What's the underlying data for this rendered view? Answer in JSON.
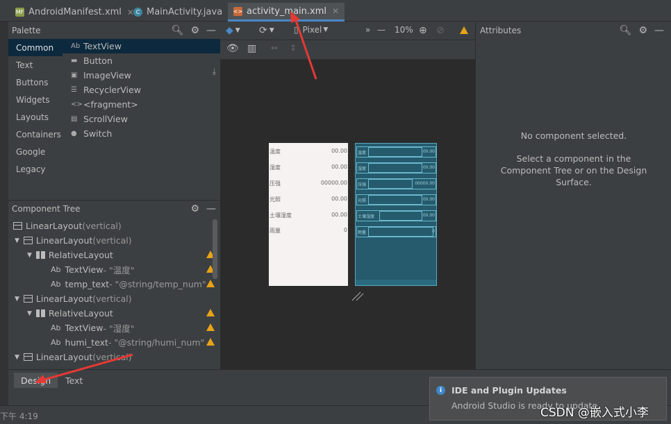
{
  "tabs": [
    {
      "label": "AndroidManifest.xml",
      "icon": "manifest-file-icon",
      "color": "#8a9c4a"
    },
    {
      "label": "MainActivity.java",
      "icon": "java-class-icon",
      "color": "#3e86a0"
    },
    {
      "label": "activity_main.xml",
      "icon": "layout-xml-icon",
      "color": "#c86a3a"
    }
  ],
  "palette": {
    "title": "Palette",
    "categories": [
      "Common",
      "Text",
      "Buttons",
      "Widgets",
      "Layouts",
      "Containers",
      "Google",
      "Legacy"
    ],
    "items": [
      {
        "prefix": "Ab",
        "label": "TextView"
      },
      {
        "prefix": "▬",
        "label": "Button"
      },
      {
        "prefix": "▣",
        "label": "ImageView"
      },
      {
        "prefix": "☰",
        "label": "RecyclerView"
      },
      {
        "prefix": "<>",
        "label": "<fragment>"
      },
      {
        "prefix": "▤",
        "label": "ScrollView"
      },
      {
        "prefix": "●",
        "label": "Switch"
      }
    ]
  },
  "tree": {
    "title": "Component Tree",
    "rows": [
      {
        "label": "LinearLayout",
        "suffix": "(vertical)"
      },
      {
        "label": "LinearLayout",
        "suffix": "(vertical)"
      },
      {
        "label": "RelativeLayout",
        "suffix": ""
      },
      {
        "label": "TextView",
        "suffix": "- \"温度\""
      },
      {
        "label": "temp_text",
        "suffix": "- \"@string/temp_num\""
      },
      {
        "label": "LinearLayout",
        "suffix": "(vertical)"
      },
      {
        "label": "RelativeLayout",
        "suffix": ""
      },
      {
        "label": "TextView",
        "suffix": "- \"湿度\""
      },
      {
        "label": "humi_text",
        "suffix": "- \"@string/humi_num\""
      },
      {
        "label": "LinearLayout",
        "suffix": "(vertical)"
      }
    ]
  },
  "toolbar": {
    "device": "Pixel",
    "zoom": "10%"
  },
  "preview": {
    "rows": [
      {
        "label": "温度",
        "value": "00.00"
      },
      {
        "label": "湿度",
        "value": "00.00"
      },
      {
        "label": "压强",
        "value": "00000.00"
      },
      {
        "label": "光照",
        "value": "00.00"
      },
      {
        "label": "土壤湿度",
        "value": "00.00"
      },
      {
        "label": "雨量",
        "value": "0"
      }
    ],
    "blueprint": [
      {
        "label": "温度",
        "value": "00.00"
      },
      {
        "label": "湿度",
        "value": "00.00"
      },
      {
        "label": "压强",
        "value": "00000.00"
      },
      {
        "label": "光照",
        "value": "00.00"
      },
      {
        "label": "土壤湿度",
        "value": "00.00"
      },
      {
        "label": "雨量",
        "value": "0"
      }
    ]
  },
  "attributes": {
    "title": "Attributes",
    "empty": "No component selected.",
    "hint_line1": "Select a component in the",
    "hint_line2": "Component Tree or on the Design",
    "hint_line3": "Surface."
  },
  "bottom_tabs": [
    "Design",
    "Text"
  ],
  "status": {
    "time": "下午 4:19"
  },
  "notification": {
    "title": "IDE and Plugin Updates",
    "body": "Android Studio is ready to update."
  },
  "watermark": "CSDN @嵌入式小李",
  "colors": {
    "accent": "#4a88c7",
    "warning": "#e8a317",
    "arrow": "#e53935"
  }
}
